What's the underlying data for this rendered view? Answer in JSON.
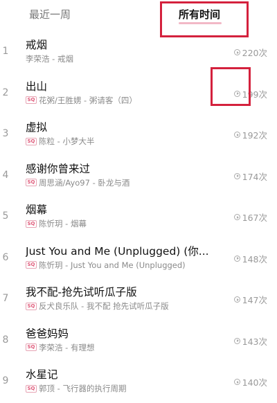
{
  "tabs": {
    "recent": "最近一周",
    "all_time": "所有时间"
  },
  "songs": [
    {
      "rank": "1",
      "title": "戒烟",
      "subtitle": "李荣浩 - 戒烟",
      "sq": false,
      "count": "220次"
    },
    {
      "rank": "2",
      "title": "出山",
      "subtitle": "花粥/王胜娚 - 粥请客（四）",
      "sq": true,
      "count": "199次"
    },
    {
      "rank": "3",
      "title": "虚拟",
      "subtitle": "陈粒 - 小梦大半",
      "sq": true,
      "count": "192次"
    },
    {
      "rank": "4",
      "title": "感谢你曾来过",
      "subtitle": "周思涵/Ayo97 - 卧龙与酒",
      "sq": true,
      "count": "174次"
    },
    {
      "rank": "5",
      "title": "烟幕",
      "subtitle": "陈忻玥 - 烟幕",
      "sq": true,
      "count": "167次"
    },
    {
      "rank": "6",
      "title": "Just You and Me (Unplugged) (你...",
      "subtitle": "陈忻玥 - Just You and Me (Unplugged)",
      "sq": true,
      "count": "148次"
    },
    {
      "rank": "7",
      "title": "我不配-抢先试听瓜子版",
      "subtitle": "反犬良乐队 - 我不配 抢先试听瓜子版",
      "sq": true,
      "count": "147次"
    },
    {
      "rank": "8",
      "title": "爸爸妈妈",
      "subtitle": "李荣浩 - 有理想",
      "sq": true,
      "count": "143次"
    },
    {
      "rank": "9",
      "title": "水星记",
      "subtitle": "郭顶 - 飞行器的执行周期",
      "sq": true,
      "count": "140次"
    }
  ],
  "sq_badge": "SQ",
  "icons": {
    "play_count": "play-circle-icon"
  },
  "colors": {
    "highlight": "#d4213d",
    "tab_underline": "#f2b8c6",
    "sq_badge": "#e05a7a"
  }
}
